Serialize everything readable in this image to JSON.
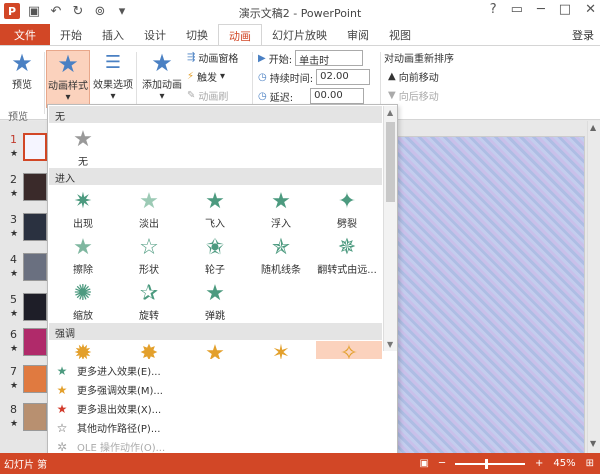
{
  "app": {
    "title": "演示文稿2 - PowerPoint",
    "window_buttons": [
      "?",
      "▭",
      "─",
      "□",
      "✕"
    ],
    "login": "登录"
  },
  "tabs": [
    "文件",
    "开始",
    "插入",
    "设计",
    "切换",
    "动画",
    "幻灯片放映",
    "审阅",
    "视图"
  ],
  "ribbon": {
    "preview": "预览",
    "preview_group": "预览",
    "anim_style": "动画样式",
    "effect_options": "效果选项",
    "add_anim": "添加动画",
    "anim_pane": "动画窗格",
    "trigger": "触发",
    "anim_painter": "动画刷",
    "start_label": "开始:",
    "start_value": "单击时",
    "duration_label": "持续时间:",
    "duration_value": "02.00",
    "delay_label": "延迟:",
    "delay_value": "00.00",
    "reorder": "对动画重新排序",
    "move_forward": "向前移动",
    "move_back": "向后移动"
  },
  "slides": [
    {
      "num": "1",
      "star": "★"
    },
    {
      "num": "2",
      "star": "★"
    },
    {
      "num": "3",
      "star": "★"
    },
    {
      "num": "4",
      "star": "★"
    },
    {
      "num": "5",
      "star": "★"
    },
    {
      "num": "6",
      "star": "★"
    },
    {
      "num": "7",
      "star": "★"
    },
    {
      "num": "8",
      "star": "★"
    }
  ],
  "gallery": {
    "none_header": "无",
    "none_label": "无",
    "enter_header": "进入",
    "enter_items": [
      "出现",
      "淡出",
      "飞入",
      "浮入",
      "劈裂",
      "擦除",
      "形状",
      "轮子",
      "随机线条",
      "翻转式由远...",
      "缩放",
      "旋转",
      "弹跳"
    ],
    "emph_header": "强调"
  },
  "menu": [
    {
      "label": "更多进入效果(E)...",
      "icon": "green-star-icon"
    },
    {
      "label": "更多强调效果(M)...",
      "icon": "yellow-star-icon"
    },
    {
      "label": "更多退出效果(X)...",
      "icon": "red-star-icon"
    },
    {
      "label": "其他动作路径(P)...",
      "icon": "outline-star-icon"
    },
    {
      "label": "OLE 操作动作(O)...",
      "icon": "ole-icon"
    }
  ],
  "status": {
    "left": "幻灯片 第",
    "zoom": "45%"
  },
  "colors": {
    "accent": "#d24726",
    "enter": "#4c9a7f",
    "emphasis": "#e3a02c",
    "exit": "#d23b2c"
  }
}
